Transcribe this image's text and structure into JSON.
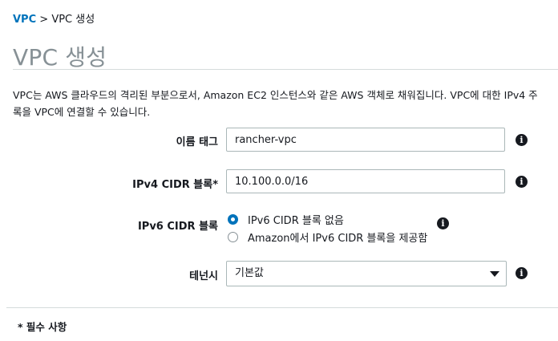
{
  "breadcrumb": {
    "root": "VPC",
    "separator": ">",
    "current": "VPC 생성"
  },
  "page_title": "VPC 생성",
  "description": {
    "line1": "VPC는 AWS 클라우드의 격리된 부분으로서, Amazon EC2 인스턴스와 같은 AWS 객체로 채워집니다. VPC에 대한 IPv4 주",
    "line2": "록을 VPC에 연결할 수 있습니다."
  },
  "form": {
    "name_tag": {
      "label": "이름 태그",
      "value": "rancher-vpc"
    },
    "ipv4_cidr": {
      "label": "IPv4 CIDR 블록*",
      "value": "10.100.0.0/16"
    },
    "ipv6_cidr": {
      "label": "IPv6 CIDR 블록",
      "options": [
        {
          "label": "IPv6 CIDR 블록 없음",
          "selected": true
        },
        {
          "label": "Amazon에서 IPv6 CIDR 블록을 제공함",
          "selected": false
        }
      ]
    },
    "tenancy": {
      "label": "테넌시",
      "value": "기본값"
    }
  },
  "info_glyph": "i",
  "required_note": "* 필수 사항",
  "colors": {
    "link": "#0073bb",
    "title": "#879196",
    "radio_selected": "#0073bb",
    "border": "#aab7b8"
  }
}
